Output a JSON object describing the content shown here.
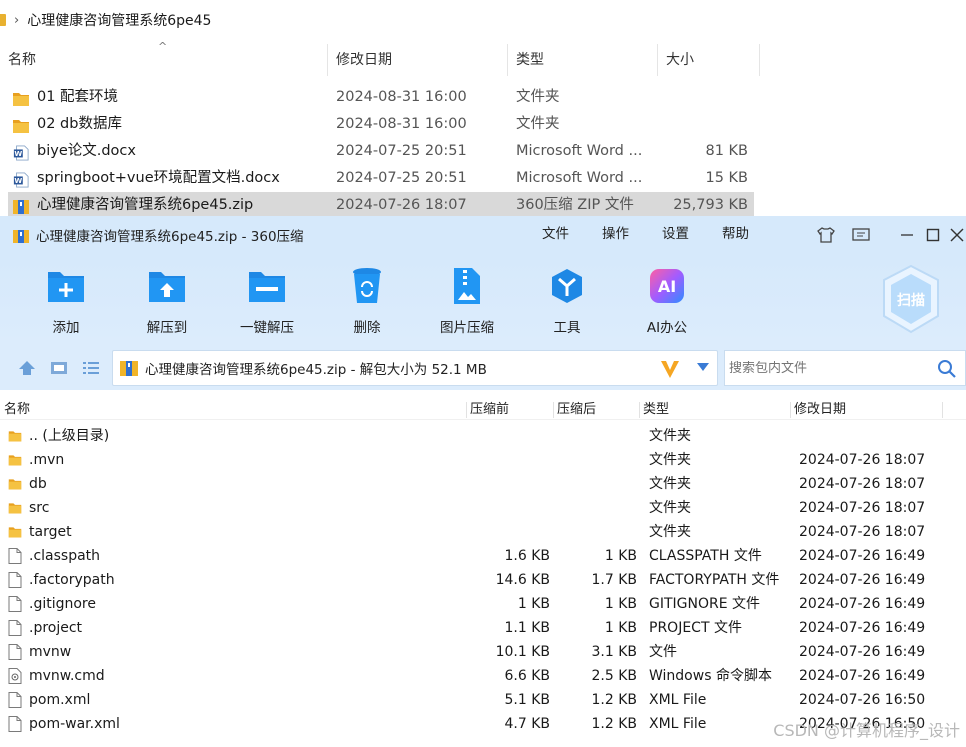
{
  "explorer": {
    "breadcrumb": "心理健康咨询管理系统6pe45",
    "columns": [
      "名称",
      "修改日期",
      "类型",
      "大小"
    ],
    "rows": [
      {
        "icon": "folder-icon",
        "name": "01 配套环境",
        "date": "2024-08-31 16:00",
        "type": "文件夹",
        "size": ""
      },
      {
        "icon": "folder-icon",
        "name": "02 db数据库",
        "date": "2024-08-31 16:00",
        "type": "文件夹",
        "size": ""
      },
      {
        "icon": "word-doc-icon",
        "name": "biye论文.docx",
        "date": "2024-07-25 20:51",
        "type": "Microsoft Word ...",
        "size": "81 KB"
      },
      {
        "icon": "word-doc-icon",
        "name": "springboot+vue环境配置文档.docx",
        "date": "2024-07-25 20:51",
        "type": "Microsoft Word ...",
        "size": "15 KB"
      },
      {
        "icon": "zip-archive-icon",
        "name": "心理健康咨询管理系统6pe45.zip",
        "date": "2024-07-26 18:07",
        "type": "360压缩 ZIP 文件",
        "size": "25,793 KB",
        "selected": true
      }
    ]
  },
  "zip_window": {
    "title": "心理健康咨询管理系统6pe45.zip - 360压缩",
    "menu": [
      "文件",
      "操作",
      "设置",
      "帮助"
    ],
    "toolbar": [
      {
        "icon": "add-folder-icon",
        "label": "添加"
      },
      {
        "icon": "extract-to-icon",
        "label": "解压到"
      },
      {
        "icon": "one-click-extract-icon",
        "label": "一键解压"
      },
      {
        "icon": "recycle-bin-icon",
        "label": "删除"
      },
      {
        "icon": "image-compress-icon",
        "label": "图片压缩"
      },
      {
        "icon": "tools-icon",
        "label": "工具"
      },
      {
        "icon": "ai-icon",
        "label": "AI办公"
      }
    ],
    "scan_label": "扫描",
    "path_text": "心理健康咨询管理系统6pe45.zip - 解包大小为 52.1 MB",
    "search_placeholder": "搜索包内文件",
    "columns": [
      "名称",
      "压缩前",
      "压缩后",
      "类型",
      "修改日期"
    ],
    "rows": [
      {
        "icon": "folder-icon",
        "name": ".. (上级目录)",
        "before": "",
        "after": "",
        "type": "文件夹",
        "date": ""
      },
      {
        "icon": "folder-icon",
        "name": ".mvn",
        "before": "",
        "after": "",
        "type": "文件夹",
        "date": "2024-07-26 18:07"
      },
      {
        "icon": "folder-icon",
        "name": "db",
        "before": "",
        "after": "",
        "type": "文件夹",
        "date": "2024-07-26 18:07"
      },
      {
        "icon": "folder-icon",
        "name": "src",
        "before": "",
        "after": "",
        "type": "文件夹",
        "date": "2024-07-26 18:07"
      },
      {
        "icon": "folder-icon",
        "name": "target",
        "before": "",
        "after": "",
        "type": "文件夹",
        "date": "2024-07-26 18:07"
      },
      {
        "icon": "file-icon",
        "name": ".classpath",
        "before": "1.6 KB",
        "after": "1 KB",
        "type": "CLASSPATH 文件",
        "date": "2024-07-26 16:49"
      },
      {
        "icon": "file-icon",
        "name": ".factorypath",
        "before": "14.6 KB",
        "after": "1.7 KB",
        "type": "FACTORYPATH 文件",
        "date": "2024-07-26 16:49"
      },
      {
        "icon": "file-icon",
        "name": ".gitignore",
        "before": "1 KB",
        "after": "1 KB",
        "type": "GITIGNORE 文件",
        "date": "2024-07-26 16:49"
      },
      {
        "icon": "file-icon",
        "name": ".project",
        "before": "1.1 KB",
        "after": "1 KB",
        "type": "PROJECT 文件",
        "date": "2024-07-26 16:49"
      },
      {
        "icon": "file-icon",
        "name": "mvnw",
        "before": "10.1 KB",
        "after": "3.1 KB",
        "type": "文件",
        "date": "2024-07-26 16:49"
      },
      {
        "icon": "cmd-script-icon",
        "name": "mvnw.cmd",
        "before": "6.6 KB",
        "after": "2.5 KB",
        "type": "Windows 命令脚本",
        "date": "2024-07-26 16:49"
      },
      {
        "icon": "file-icon",
        "name": "pom.xml",
        "before": "5.1 KB",
        "after": "1.2 KB",
        "type": "XML File",
        "date": "2024-07-26 16:50"
      },
      {
        "icon": "file-icon",
        "name": "pom-war.xml",
        "before": "4.7 KB",
        "after": "1.2 KB",
        "type": "XML File",
        "date": "2024-07-26 16:50"
      }
    ]
  },
  "watermark": "CSDN @计算机程序_设计",
  "colors": {
    "accent": "#1e88e5",
    "title_bg": "#d6e9fb",
    "folder": "#f0b429"
  }
}
